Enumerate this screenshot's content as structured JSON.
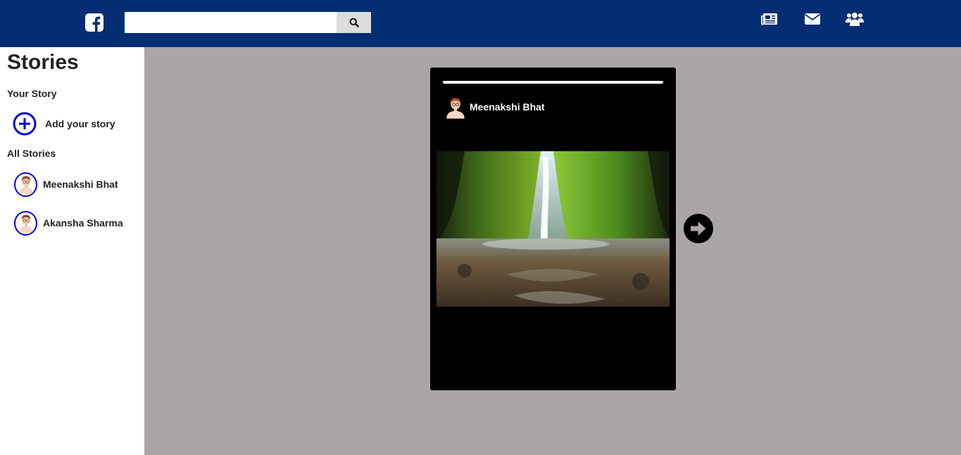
{
  "header": {
    "logo_icon": "facebook-logo-icon",
    "search": {
      "value": "",
      "placeholder": "",
      "button_icon": "search-icon"
    },
    "nav_icons": [
      "newspaper-icon",
      "envelope-icon",
      "users-icon"
    ],
    "background_color": "#032e74"
  },
  "sidebar": {
    "title": "Stories",
    "your_story_label": "Your Story",
    "add_story_label": "Add your story",
    "all_stories_label": "All Stories",
    "stories": [
      {
        "name": "Meenakshi Bhat"
      },
      {
        "name": "Akansha Sharma"
      }
    ]
  },
  "viewer": {
    "user_name": "Meenakshi Bhat",
    "progress": 1.0,
    "image": "waterfall-canyon-photo",
    "next_icon": "arrow-right-circle-icon"
  }
}
